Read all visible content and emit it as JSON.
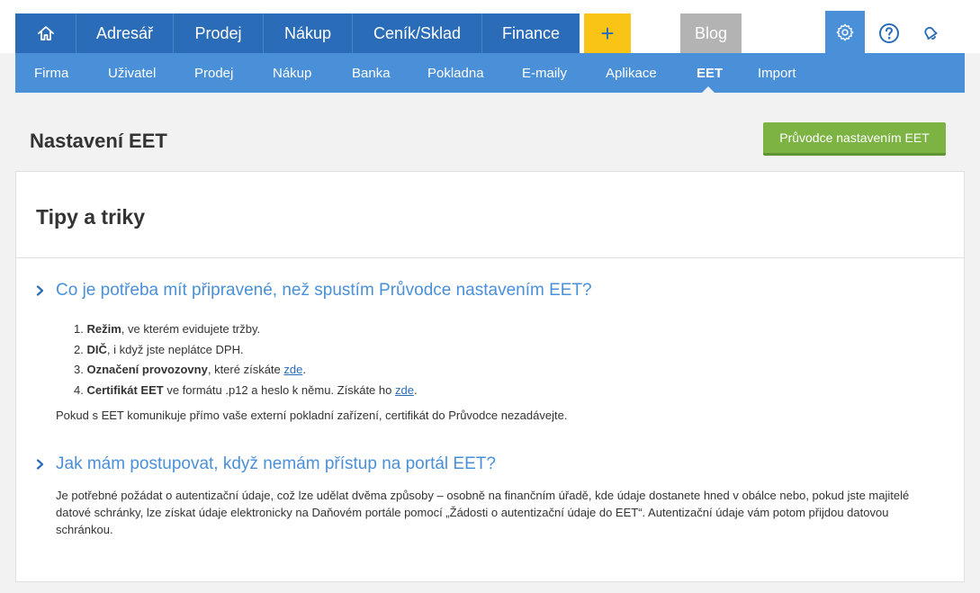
{
  "main_nav": {
    "home_icon": "home-icon",
    "items": [
      "Adresář",
      "Prodej",
      "Nákup",
      "Ceník/Sklad",
      "Finance"
    ],
    "plus_label": "+",
    "blog_label": "Blog"
  },
  "top_icons": [
    "gear-icon",
    "help-icon",
    "bell-icon"
  ],
  "sub_nav": {
    "items": [
      "Firma",
      "Uživatel",
      "Prodej",
      "Nákup",
      "Banka",
      "Pokladna",
      "E-maily",
      "Aplikace",
      "EET",
      "Import"
    ],
    "active": "EET"
  },
  "page": {
    "title": "Nastavení EET",
    "wizard_button": "Průvodce nastavením EET"
  },
  "card": {
    "title": "Tipy a triky",
    "faq1": {
      "question": "Co je potřeba mít připravené, než spustím Průvodce nastavením EET?",
      "items": [
        {
          "num": "1.",
          "bold": "Režim",
          "rest": ", ve kterém evidujete tržby.",
          "link": "",
          "tail": ""
        },
        {
          "num": "2.",
          "bold": "DIČ",
          "rest": ", i když jste neplátce DPH.",
          "link": "",
          "tail": ""
        },
        {
          "num": "3.",
          "bold": "Označení provozovny",
          "rest": ", které získáte ",
          "link": "zde",
          "tail": "."
        },
        {
          "num": "4.",
          "bold": "Certifikát EET",
          "rest": " ve formátu .p12 a heslo k němu. Získáte ho ",
          "link": "zde",
          "tail": "."
        }
      ],
      "note": "Pokud s EET komunikuje přímo vaše externí pokladní zařízení, certifikát do Průvodce nezadávejte."
    },
    "faq2": {
      "question": "Jak mám postupovat, když nemám přístup na portál EET?",
      "paragraph": "Je potřebné požádat o autentizační údaje, což lze udělat dvěma způsoby – osobně na finančním úřadě, kde údaje dostanete hned v obálce nebo, pokud jste majitelé datové schránky, lze získat údaje elektronicky na Daňovém portále pomocí „Žádosti o autentizační údaje do EET“. Autentizační údaje vám potom přijdou datovou schránkou."
    }
  },
  "colors": {
    "primary": "#2b6cb8",
    "secondary": "#4a90d9",
    "accent_yellow": "#f9c416",
    "green": "#7cb342",
    "gray": "#b3b3b3"
  }
}
